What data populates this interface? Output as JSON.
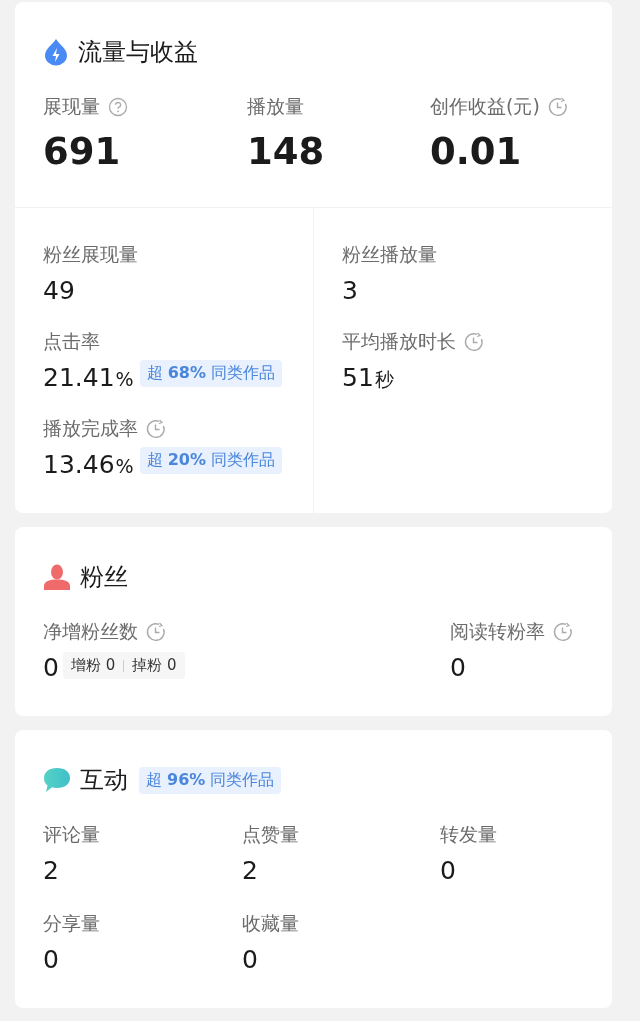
{
  "cards": [
    {
      "kind": "traffic",
      "title": "流量与收益",
      "top_metrics": [
        {
          "kind": "help",
          "label": "展现量",
          "value": "691"
        },
        {
          "kind": "plain",
          "label": "播放量",
          "value": "148"
        },
        {
          "kind": "history",
          "label": "创作收益(元)",
          "value": "0.01"
        }
      ],
      "columns": [
        [
          {
            "kind": "plain",
            "label": "粉丝展现量",
            "value": "49"
          },
          {
            "kind": "plain",
            "label": "点击率",
            "value": "21.41",
            "unit": "%",
            "badge": "超 **68%** 同类作品"
          },
          {
            "kind": "history",
            "label": "播放完成率",
            "value": "13.46",
            "unit": "%",
            "badge": "超 **20%** 同类作品"
          }
        ],
        [
          {
            "kind": "plain",
            "label": "粉丝播放量",
            "value": "3"
          },
          {
            "kind": "history",
            "label": "平均播放时长",
            "value": "51",
            "unit": "秒"
          }
        ]
      ]
    },
    {
      "kind": "fans",
      "title": "粉丝",
      "metrics": [
        {
          "kind": "history",
          "label": "净增粉丝数",
          "value": "0",
          "breakdown": [
            {
              "label": "增粉",
              "value": "0"
            },
            {
              "label": "掉粉",
              "value": "0"
            }
          ]
        },
        {
          "kind": "history",
          "label": "阅读转粉率",
          "value": "0"
        }
      ]
    },
    {
      "kind": "interaction",
      "title": "互动",
      "badge": "超 **96%** 同类作品",
      "metrics": [
        {
          "kind": "plain",
          "label": "评论量",
          "value": "2"
        },
        {
          "kind": "plain",
          "label": "点赞量",
          "value": "2"
        },
        {
          "kind": "plain",
          "label": "转发量",
          "value": "0"
        },
        {
          "kind": "plain",
          "label": "分享量",
          "value": "0"
        },
        {
          "kind": "plain",
          "label": "收藏量",
          "value": "0"
        }
      ]
    }
  ]
}
